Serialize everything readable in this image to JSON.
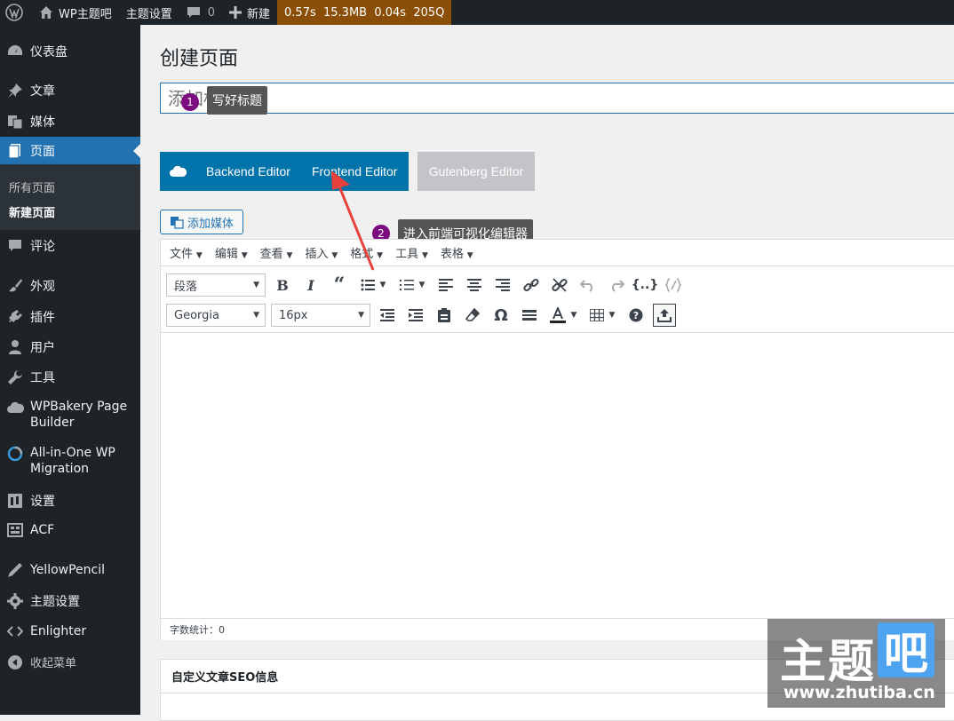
{
  "adminbar": {
    "site_name": "WP主题吧",
    "theme_settings": "主题设置",
    "comments_count": "0",
    "new_label": "新建",
    "perf": "0.57s  15.3MB  0.04s  205Q"
  },
  "sidebar": {
    "items": [
      {
        "label": "仪表盘",
        "icon": "dashboard-icon"
      },
      {
        "label": "文章",
        "icon": "pin-icon"
      },
      {
        "label": "媒体",
        "icon": "media-icon"
      },
      {
        "label": "页面",
        "icon": "page-icon"
      },
      {
        "label": "评论",
        "icon": "comment-icon"
      },
      {
        "label": "外观",
        "icon": "brush-icon"
      },
      {
        "label": "插件",
        "icon": "plugin-icon"
      },
      {
        "label": "用户",
        "icon": "user-icon"
      },
      {
        "label": "工具",
        "icon": "wrench-icon"
      },
      {
        "label": "WPBakery Page Builder",
        "icon": "cloud-icon"
      },
      {
        "label": "All-in-One WP Migration",
        "icon": "migration-icon"
      },
      {
        "label": "设置",
        "icon": "settings-icon"
      },
      {
        "label": "ACF",
        "icon": "acf-icon"
      },
      {
        "label": "YellowPencil",
        "icon": "pencil-icon"
      },
      {
        "label": "主题设置",
        "icon": "gear-icon"
      },
      {
        "label": "Enlighter",
        "icon": "code-icon"
      },
      {
        "label": "收起菜单",
        "icon": "collapse-icon"
      }
    ],
    "submenu": [
      "所有页面",
      "新建页面"
    ]
  },
  "main": {
    "page_title": "创建页面",
    "title_placeholder": "添加标题",
    "tip1": "写好标题",
    "tip1_num": "1",
    "tip2": "进入前端可视化编辑器",
    "tip2_num": "2",
    "backend_editor": "Backend Editor",
    "frontend_editor": "Frontend Editor",
    "gutenberg_editor": "Gutenberg Editor",
    "add_media": "添加媒体"
  },
  "editor": {
    "menus": [
      "文件",
      "编辑",
      "查看",
      "插入",
      "格式",
      "工具",
      "表格"
    ],
    "paragraph_select": "段落",
    "font_select": "Georgia",
    "size_select": "16px",
    "word_count": "字数统计：0",
    "code_button": "{..}"
  },
  "seo": {
    "title": "自定义文章SEO信息"
  },
  "watermark": {
    "main": "主题",
    "ba": "吧",
    "url": "www.zhutiba.cn"
  },
  "colors": {
    "admin_dark": "#1d2327",
    "wp_blue": "#2271b1",
    "wpb_blue": "#0073aa",
    "perf_orange": "#8a4e06",
    "tip_badge": "#7b0b7e"
  }
}
